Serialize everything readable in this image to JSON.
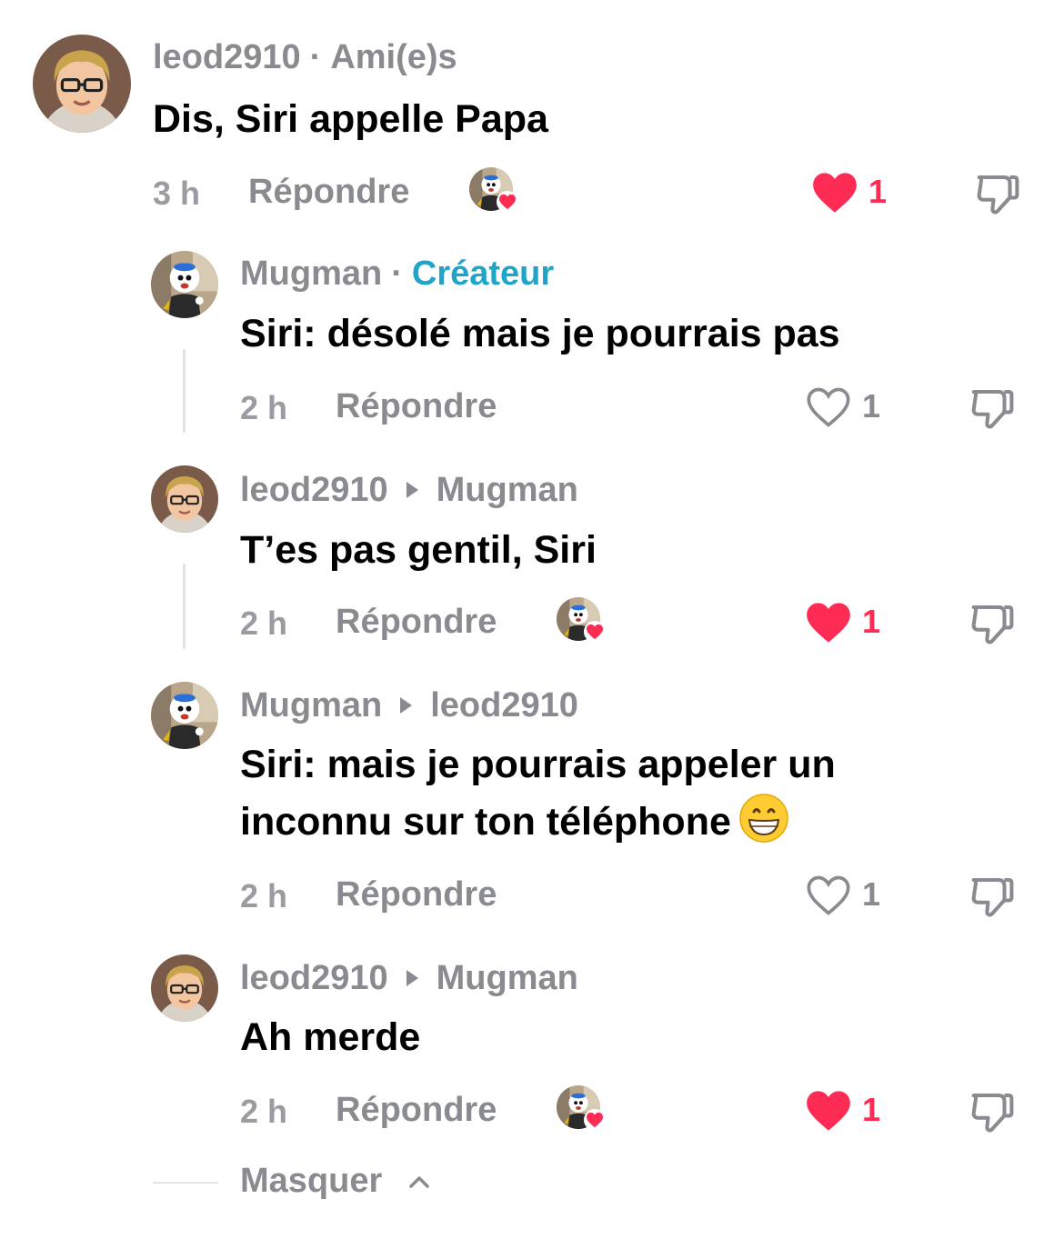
{
  "comments": [
    {
      "user": "leod2910",
      "tag": "Ami(e)s",
      "text": "Dis, Siri appelle Papa",
      "time": "3 h",
      "reply_label": "Répondre",
      "likes": "1",
      "liked": true,
      "creator_liked": true
    },
    {
      "user": "Mugman",
      "tag": "Créateur",
      "text": "Siri: désolé mais je pourrais pas",
      "time": "2 h",
      "reply_label": "Répondre",
      "likes": "1",
      "liked": false,
      "creator_liked": false
    },
    {
      "user": "leod2910",
      "reply_to": "Mugman",
      "text": "T’es pas gentil, Siri",
      "time": "2 h",
      "reply_label": "Répondre",
      "likes": "1",
      "liked": true,
      "creator_liked": true
    },
    {
      "user": "Mugman",
      "reply_to": "leod2910",
      "text": "Siri: mais je pourrais appeler un inconnu sur ton téléphone",
      "emoji": "grinning-face",
      "time": "2 h",
      "reply_label": "Répondre",
      "likes": "1",
      "liked": false,
      "creator_liked": false
    },
    {
      "user": "leod2910",
      "reply_to": "Mugman",
      "text": "Ah merde",
      "time": "2 h",
      "reply_label": "Répondre",
      "likes": "1",
      "liked": true,
      "creator_liked": true
    }
  ],
  "hide_replies_label": "Masquer",
  "colors": {
    "like_red": "#fe2c55",
    "creator_blue": "#20a5c9",
    "muted_grey": "#8a8b91"
  }
}
